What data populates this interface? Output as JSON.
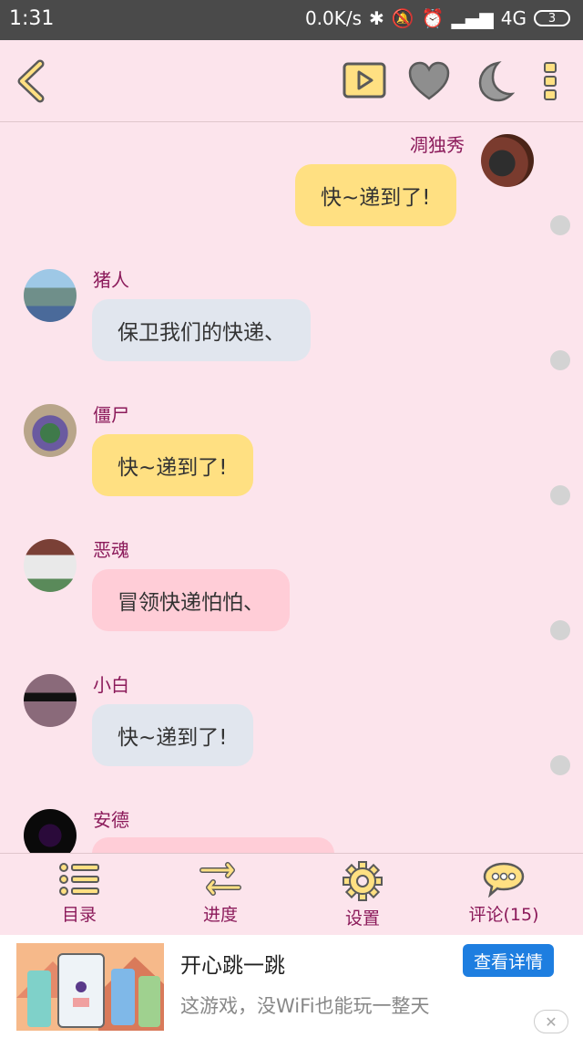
{
  "status_bar": {
    "time": "1:31",
    "network_speed": "0.0K/s",
    "network_type": "4G",
    "battery": "3"
  },
  "toolbar": {
    "back_icon": "chevron-left-icon",
    "play_icon": "play-icon",
    "favorite_icon": "heart-icon",
    "night_mode_icon": "moon-icon",
    "more_icon": "more-vertical-icon"
  },
  "messages": [
    {
      "name": "凋独秀",
      "text": "快~递到了!",
      "side": "right",
      "bubble_color": "#ffe082"
    },
    {
      "name": "猪人",
      "text": "保卫我们的快递、",
      "side": "left",
      "bubble_color": "#e1e6ee"
    },
    {
      "name": "僵尸",
      "text": "快~递到了!",
      "side": "left",
      "bubble_color": "#ffe082"
    },
    {
      "name": "恶魂",
      "text": "冒领快递怕怕、",
      "side": "left",
      "bubble_color": "#ffcdd7"
    },
    {
      "name": "小白",
      "text": "快~递到了!",
      "side": "left",
      "bubble_color": "#e1e6ee"
    },
    {
      "name": "安德",
      "text": "",
      "side": "left",
      "bubble_color": "#ffcdd7"
    }
  ],
  "tabs": [
    {
      "label": "目录",
      "icon": "list-icon"
    },
    {
      "label": "进度",
      "icon": "swap-arrows-icon"
    },
    {
      "label": "设置",
      "icon": "gear-icon"
    },
    {
      "label": "评论(15)",
      "icon": "comment-bubble-icon"
    }
  ],
  "ad": {
    "title": "开心跳一跳",
    "description": "这游戏，没WiFi也能玩一整天",
    "button": "查看详情",
    "close": "✕"
  },
  "colors": {
    "background": "#fce4ec",
    "name_text": "#8b1a5a",
    "icon_yellow": "#ffe082",
    "icon_outline": "#5a5a5a",
    "ad_button": "#1e7ee0"
  }
}
